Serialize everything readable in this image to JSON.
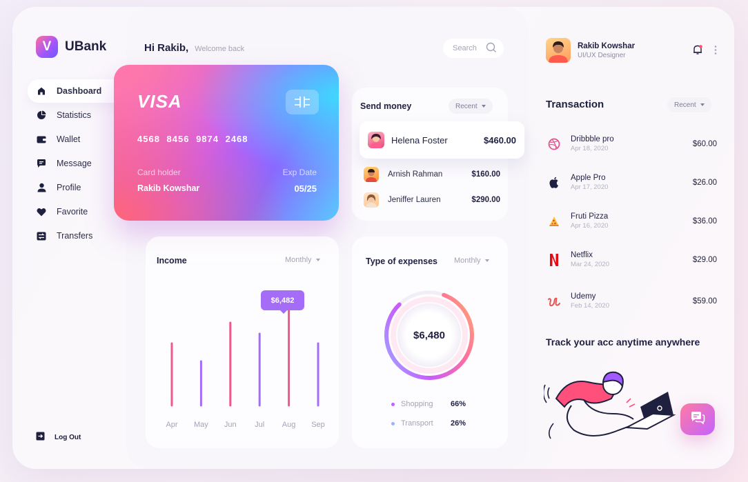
{
  "app": {
    "name": "UBank",
    "logo_letter": "V"
  },
  "sidebar": {
    "items": [
      {
        "label": "Dashboard",
        "icon": "home-icon",
        "active": true
      },
      {
        "label": "Statistics",
        "icon": "pie-chart-icon",
        "active": false
      },
      {
        "label": "Wallet",
        "icon": "wallet-icon",
        "active": false
      },
      {
        "label": "Message",
        "icon": "message-icon",
        "active": false
      },
      {
        "label": "Profile",
        "icon": "user-icon",
        "active": false
      },
      {
        "label": "Favorite",
        "icon": "heart-icon",
        "active": false
      },
      {
        "label": "Transfers",
        "icon": "transfer-icon",
        "active": false
      }
    ],
    "logout_label": "Log Out"
  },
  "header": {
    "greeting": "Hi Rakib,",
    "subtitle": "Welcome back",
    "search_placeholder": "Search"
  },
  "card": {
    "brand": "VISA",
    "number": "4568 8456 9874 2468",
    "holder_label": "Card holder",
    "holder_name": "Rakib Kowshar",
    "exp_label": "Exp Date",
    "exp_value": "05/25"
  },
  "send_money": {
    "title": "Send money",
    "filter": "Recent",
    "contacts": [
      {
        "name": "Helena Foster",
        "amount": "$460.00",
        "highlighted": true
      },
      {
        "name": "Arnish Rahman",
        "amount": "$160.00",
        "highlighted": false
      },
      {
        "name": "Jeniffer Lauren",
        "amount": "$290.00",
        "highlighted": false
      }
    ]
  },
  "income": {
    "title": "Income",
    "filter": "Monthly",
    "tooltip": "$6,482",
    "months": [
      "Apr",
      "May",
      "Jun",
      "Jul",
      "Aug",
      "Sep"
    ]
  },
  "expenses": {
    "title": "Type of expenses",
    "filter": "Monthly",
    "total": "$6,480",
    "legend": [
      {
        "label": "Shopping",
        "percent": "66%",
        "color": "#c75cff"
      },
      {
        "label": "Transport",
        "percent": "26%",
        "color": "#9ab3ff"
      }
    ]
  },
  "user": {
    "name": "Rakib Kowshar",
    "role": "UI/UX Designer"
  },
  "transactions": {
    "title": "Transaction",
    "filter": "Recent",
    "items": [
      {
        "name": "Dribbble pro",
        "date": "Apr 18, 2020",
        "amount": "$60.00",
        "icon": "dribbble-icon"
      },
      {
        "name": "Apple Pro",
        "date": "Apr 17, 2020",
        "amount": "$26.00",
        "icon": "apple-icon"
      },
      {
        "name": "Fruti Pizza",
        "date": "Apr 16, 2020",
        "amount": "$36.00",
        "icon": "pizza-icon"
      },
      {
        "name": "Netflix",
        "date": "Mar 24, 2020",
        "amount": "$29.00",
        "icon": "netflix-icon"
      },
      {
        "name": "Udemy",
        "date": "Feb 14, 2020",
        "amount": "$59.00",
        "icon": "udemy-icon"
      }
    ]
  },
  "promo": {
    "title": "Track your acc anytime anywhere"
  },
  "colors": {
    "accent": "#a56cf7",
    "pink": "#f0588a",
    "purple": "#a56cf7"
  },
  "chart_data": {
    "type": "bar",
    "categories": [
      "Apr",
      "May",
      "Jun",
      "Jul",
      "Aug",
      "Sep"
    ],
    "values": [
      4500,
      3200,
      6000,
      5200,
      7000,
      4500
    ],
    "title": "Income",
    "xlabel": "",
    "ylabel": "",
    "ylim": [
      0,
      8000
    ],
    "highlight": {
      "category": "Aug",
      "label": "$6,482"
    },
    "grid": false
  }
}
